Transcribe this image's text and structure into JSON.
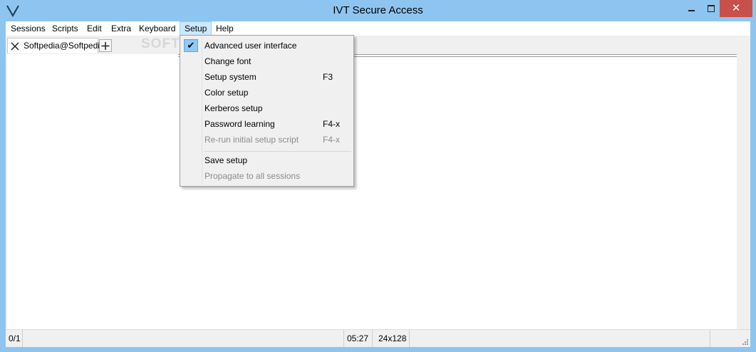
{
  "window": {
    "title": "IVT Secure Access",
    "close_glyph": "✕"
  },
  "menubar": {
    "items": [
      "Sessions",
      "Scripts",
      "Edit",
      "Extra",
      "Keyboard",
      "Setup",
      "Help"
    ],
    "active": "Setup"
  },
  "tabs": {
    "items": [
      {
        "label": "Softpedia@Softpedia"
      }
    ],
    "add_glyph": "+"
  },
  "watermark": "SOFTPEDIA",
  "setup_menu": {
    "items": [
      {
        "label": "Advanced user interface",
        "shortcut": "",
        "checked": true,
        "disabled": false
      },
      {
        "label": "Change font",
        "shortcut": "",
        "checked": false,
        "disabled": false
      },
      {
        "label": "Setup system",
        "shortcut": "F3",
        "checked": false,
        "disabled": false
      },
      {
        "label": "Color setup",
        "shortcut": "",
        "checked": false,
        "disabled": false
      },
      {
        "label": "Kerberos setup",
        "shortcut": "",
        "checked": false,
        "disabled": false
      },
      {
        "label": "Password learning",
        "shortcut": "F4-x",
        "checked": false,
        "disabled": false
      },
      {
        "label": "Re-run initial setup script",
        "shortcut": "F4-x",
        "checked": false,
        "disabled": true
      },
      {
        "label": "Save setup",
        "shortcut": "",
        "checked": false,
        "disabled": false
      },
      {
        "label": "Propagate to all sessions",
        "shortcut": "",
        "checked": false,
        "disabled": true
      }
    ],
    "check_glyph": "✔"
  },
  "statusbar": {
    "position": "0/1",
    "time": "05:27",
    "size": "24x128"
  },
  "colors": {
    "titlebar": "#8ec5f0",
    "close_button": "#c7504b",
    "menu_active": "#cce8ff",
    "check_highlight": "#90c8f6"
  }
}
